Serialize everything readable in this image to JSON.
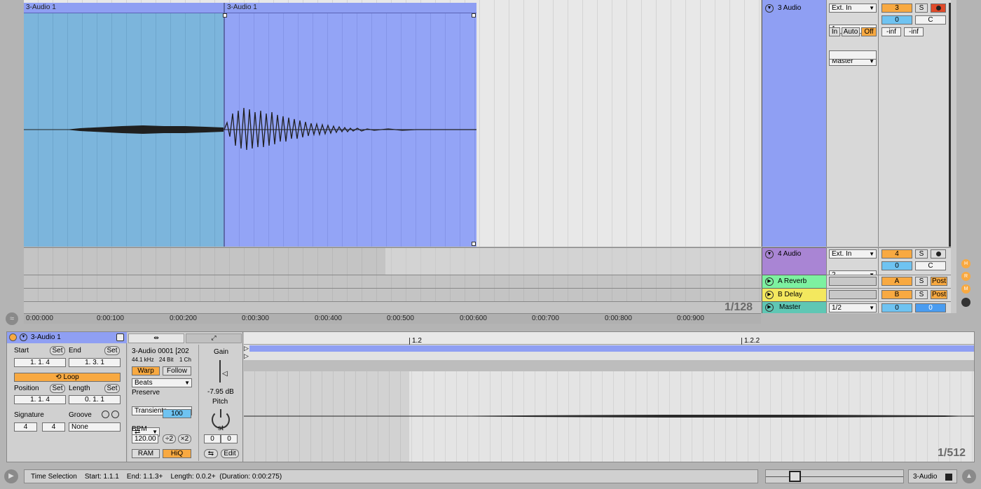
{
  "arrangement": {
    "clip_left_label": "3-Audio 1",
    "clip_right_label": "3-Audio 1",
    "zoom": "1/128",
    "ruler": [
      "0:00:000",
      "0:00:100",
      "0:00:200",
      "0:00:300",
      "0:00:400",
      "0:00:500",
      "0:00:600",
      "0:00:700",
      "0:00:800",
      "0:00:900"
    ]
  },
  "tracks": {
    "t3": {
      "name": "3 Audio",
      "input_type": "Ext. In",
      "input_channel": "1",
      "monitor_in": "In",
      "monitor_auto": "Auto",
      "monitor_off": "Off",
      "output": "Master",
      "number": "3",
      "solo": "S",
      "pan_value": "0",
      "pan_label": "C",
      "peak_l": "-inf",
      "peak_r": "-inf",
      "color": "#8f9ff3"
    },
    "t4": {
      "name": "4 Audio",
      "input_type": "Ext. In",
      "input_channel": "2",
      "number": "4",
      "solo": "S",
      "pan_value": "0",
      "pan_label": "C",
      "color": "#a985d4"
    },
    "ra": {
      "name": "A Reverb",
      "number": "A",
      "solo": "S",
      "post": "Post",
      "color": "#7df1a0"
    },
    "rb": {
      "name": "B Delay",
      "number": "B",
      "solo": "S",
      "post": "Post",
      "color": "#f3e85e"
    },
    "master": {
      "name": "Master",
      "output": "1/2",
      "vol1": "0",
      "vol2": "0",
      "color": "#5fc7b4"
    }
  },
  "right_edge_buttons": [
    "H",
    "R",
    "M"
  ],
  "clip_panel": {
    "title": "3-Audio 1",
    "start_label": "Start",
    "end_label": "End",
    "set_label": "Set",
    "start_value": "1.   1.   4",
    "end_value": "1.   3.   1",
    "loop_label": "Loop",
    "position_label": "Position",
    "length_label": "Length",
    "position_value": "1.   1.   4",
    "length_value": "0.   1.   1",
    "signature_label": "Signature",
    "groove_label": "Groove",
    "sig_num": "4",
    "sig_den": "4",
    "groove_value": "None"
  },
  "sample_panel": {
    "filename": "3-Audio 0001 [202",
    "rate": "44.1 kHz",
    "bits": "24 Bit",
    "channels": "1 Ch",
    "warp": "Warp",
    "follow": "Follow",
    "mode": "Beats",
    "preserve_label": "Preserve",
    "preserve": "Transients",
    "loop_value": "100",
    "bpm_label": "BPM",
    "bpm": "120.00",
    "half": "÷2",
    "double": "×2",
    "ram": "RAM",
    "hiq": "HiQ",
    "gain_label": "Gain",
    "gain_value": "-7.95 dB",
    "pitch_label": "Pitch",
    "pitch_unit": "st",
    "pitch_semi": "0",
    "pitch_cent": "0",
    "edit": "Edit"
  },
  "sample_editor": {
    "marker1": "1.2",
    "marker2": "1.2.2",
    "zoom": "1/512"
  },
  "status_bar": {
    "text": "Time Selection    Start: 1.1.1    End: 1.1.3+    Length: 0.0.2+  (Duration: 0:00:275)",
    "track": "3-Audio"
  }
}
